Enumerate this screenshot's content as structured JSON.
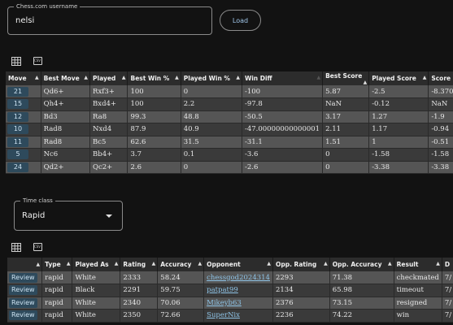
{
  "username": {
    "label": "Chess.com username",
    "value": "nelsi"
  },
  "load_label": "Load",
  "toolbar_icons": {
    "table": "table-icon",
    "csv": "CSV"
  },
  "moves_table": {
    "headers": [
      "Move",
      "Best Move",
      "Played",
      "Best Win %",
      "Played Win %",
      "Win Diff",
      "Best Score",
      "Played Score",
      "Score"
    ],
    "rows": [
      [
        "21",
        "Qd6+",
        "Rxf3+",
        "100",
        "0",
        "-100",
        "5.87",
        "-2.5",
        "-8.3700"
      ],
      [
        "15",
        "Qh4+",
        "Bxd4+",
        "100",
        "2.2",
        "-97.8",
        "NaN",
        "-0.12",
        "NaN"
      ],
      [
        "12",
        "Bd3",
        "Ra8",
        "99.3",
        "48.8",
        "-50.5",
        "3.17",
        "1.27",
        "-1.9"
      ],
      [
        "10",
        "Rad8",
        "Nxd4",
        "87.9",
        "40.9",
        "-47.00000000000001",
        "2.11",
        "1.17",
        "-0.94"
      ],
      [
        "11",
        "Rad8",
        "Bc5",
        "62.6",
        "31.5",
        "-31.1",
        "1.51",
        "1",
        "-0.51"
      ],
      [
        "5",
        "Nc6",
        "Bb4+",
        "3.7",
        "0.1",
        "-3.6",
        "0",
        "-1.58",
        "-1.58"
      ],
      [
        "24",
        "Qd2+",
        "Qc2+",
        "2.6",
        "0",
        "-2.6",
        "0",
        "-3.38",
        "-3.38"
      ]
    ]
  },
  "time_class": {
    "label": "Time class",
    "value": "Rapid"
  },
  "games_table": {
    "headers": [
      "",
      "Type",
      "Played As",
      "Rating",
      "Accuracy",
      "Opponent",
      "Opp. Rating",
      "Opp. Accuracy",
      "Result",
      "D"
    ],
    "review_label": "Review",
    "rows": [
      [
        "rapid",
        "White",
        "2333",
        "58.24",
        "chessgod2024314",
        "2293",
        "71.38",
        "checkmated",
        "7/"
      ],
      [
        "rapid",
        "Black",
        "2291",
        "59.75",
        "patpat99",
        "2134",
        "65.98",
        "timeout",
        "7/"
      ],
      [
        "rapid",
        "White",
        "2340",
        "70.06",
        "Mikeyb63",
        "2376",
        "73.15",
        "resigned",
        "7/"
      ],
      [
        "rapid",
        "White",
        "2350",
        "72.66",
        "SuperNix",
        "2236",
        "74.22",
        "win",
        "7/"
      ]
    ]
  }
}
